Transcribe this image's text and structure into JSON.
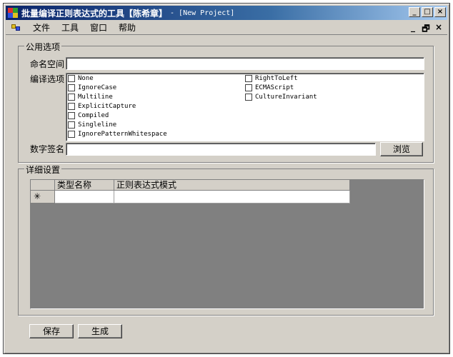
{
  "window": {
    "title": "批量编译正则表达式的工具【陈希章】",
    "subtitle": "- [New Project]",
    "buttons": {
      "minimize": "_",
      "maximize": "□",
      "close": "×"
    }
  },
  "menu": {
    "items": [
      "文件",
      "工具",
      "窗口",
      "帮助"
    ],
    "mdi_controls": {
      "minimize": "_",
      "restore": "🗗",
      "close": "×"
    }
  },
  "common_options": {
    "legend": "公用选项",
    "namespace_label": "命名空间",
    "namespace_value": "",
    "compile_options_label": "编译选项",
    "options_left": [
      "None",
      "IgnoreCase",
      "Multiline",
      "ExplicitCapture",
      "Compiled",
      "Singleline",
      "IgnorePatternWhitespace"
    ],
    "options_right": [
      "RightToLeft",
      "ECMAScript",
      "CultureInvariant"
    ],
    "signature_label": "数字签名",
    "signature_value": "",
    "browse_label": "浏览"
  },
  "details": {
    "legend": "详细设置",
    "columns": [
      "类型名称",
      "正则表达式模式"
    ],
    "new_row_marker": "✳"
  },
  "footer": {
    "save_label": "保存",
    "generate_label": "生成"
  }
}
